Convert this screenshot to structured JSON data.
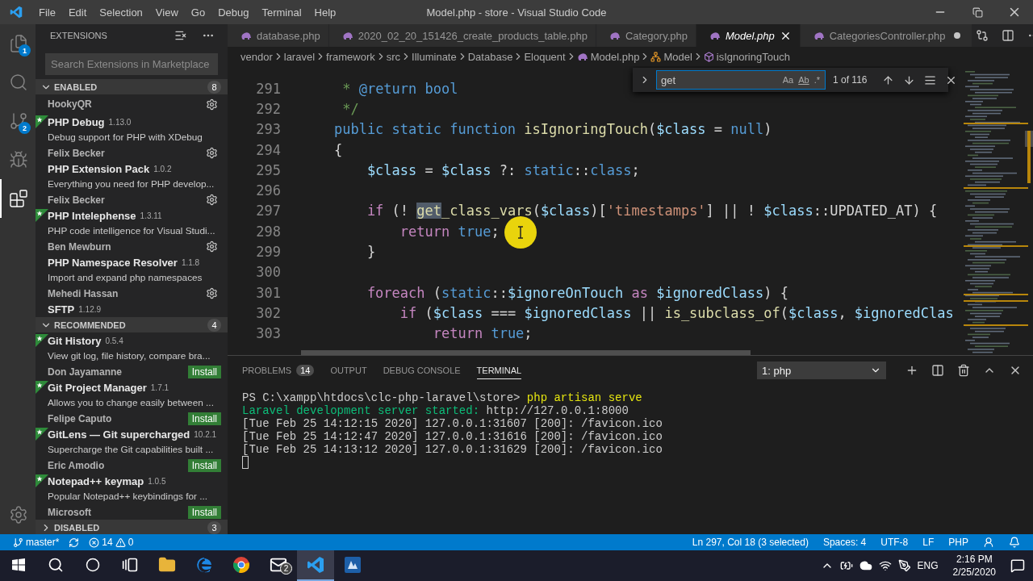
{
  "title_bar": {
    "menus": [
      "File",
      "Edit",
      "Selection",
      "View",
      "Go",
      "Debug",
      "Terminal",
      "Help"
    ],
    "title": "Model.php - store - Visual Studio Code"
  },
  "activity_bar": [
    {
      "kind": "explorer",
      "badge": "1",
      "selected": false
    },
    {
      "kind": "search",
      "selected": false
    },
    {
      "kind": "source-control",
      "badge": "2",
      "selected": false
    },
    {
      "kind": "debug",
      "selected": false
    },
    {
      "kind": "extensions",
      "selected": true
    }
  ],
  "sidebar": {
    "title": "EXTENSIONS",
    "search": {
      "placeholder": "Search Extensions in Marketplace"
    },
    "sections": [
      {
        "title": "ENABLED",
        "count": "8",
        "expanded": true,
        "items": [
          {
            "author": "HookyQR",
            "starred": false,
            "kind": "manage"
          },
          {
            "name": "PHP Debug",
            "version": "1.13.0",
            "description": "Debug support for PHP with XDebug",
            "author": "Felix Becker",
            "starred": true,
            "kind": "manage"
          },
          {
            "name": "PHP Extension Pack",
            "version": "1.0.2",
            "description": "Everything you need for PHP develop...",
            "author": "Felix Becker",
            "starred": false,
            "kind": "manage"
          },
          {
            "name": "PHP Intelephense",
            "version": "1.3.11",
            "description": "PHP code intelligence for Visual Studi...",
            "author": "Ben Mewburn",
            "starred": true,
            "kind": "manage"
          },
          {
            "name": "PHP Namespace Resolver",
            "version": "1.1.8",
            "description": "Import and expand php namespaces",
            "author": "Mehedi Hassan",
            "starred": false,
            "kind": "manage"
          },
          {
            "name": "SFTP",
            "version": "1.12.9",
            "starred": false
          }
        ]
      },
      {
        "title": "RECOMMENDED",
        "count": "4",
        "expanded": true,
        "items": [
          {
            "name": "Git History",
            "version": "0.5.4",
            "description": "View git log, file history, compare bra...",
            "author": "Don Jayamanne",
            "starred": true,
            "kind": "install",
            "action_label": "Install"
          },
          {
            "name": "Git Project Manager",
            "version": "1.7.1",
            "description": "Allows you to change easily between ...",
            "author": "Felipe Caputo",
            "starred": true,
            "kind": "install",
            "action_label": "Install"
          },
          {
            "name": "GitLens — Git supercharged",
            "version": "10.2.1",
            "description": "Supercharge the Git capabilities built ...",
            "author": "Eric Amodio",
            "starred": true,
            "kind": "install",
            "action_label": "Install"
          },
          {
            "name": "Notepad++ keymap",
            "version": "1.0.5",
            "description": "Popular Notepad++ keybindings for ...",
            "author": "Microsoft",
            "starred": true,
            "kind": "install",
            "action_label": "Install"
          }
        ]
      },
      {
        "title": "DISABLED",
        "count": "3",
        "expanded": false
      }
    ]
  },
  "tabs": [
    {
      "label": "database.php",
      "selected": false,
      "preview": false,
      "modified": false
    },
    {
      "label": "2020_02_20_151426_create_products_table.php",
      "selected": false,
      "preview": false,
      "modified": false
    },
    {
      "label": "Category.php",
      "selected": false,
      "preview": false,
      "modified": false
    },
    {
      "label": "Model.php",
      "selected": true,
      "preview": true,
      "modified": false
    },
    {
      "label": "CategoriesController.php",
      "selected": false,
      "preview": false,
      "modified": true
    }
  ],
  "breadcrumb": [
    {
      "kind": "folder",
      "label": "vendor"
    },
    {
      "kind": "folder",
      "label": "laravel"
    },
    {
      "kind": "folder",
      "label": "framework"
    },
    {
      "kind": "folder",
      "label": "src"
    },
    {
      "kind": "folder",
      "label": "Illuminate"
    },
    {
      "kind": "folder",
      "label": "Database"
    },
    {
      "kind": "folder",
      "label": "Eloquent"
    },
    {
      "kind": "file",
      "label": "Model.php"
    },
    {
      "kind": "class",
      "label": "Model"
    },
    {
      "kind": "method",
      "label": "isIgnoringTouch"
    }
  ],
  "find": {
    "value": "get",
    "toggles": [
      "Aa",
      "Ab",
      ".*"
    ],
    "result": "1 of 116"
  },
  "code": [
    {
      "number": "291",
      "tokens": [
        {
          "kind": "cm",
          "text": "     * "
        },
        {
          "kind": "kw",
          "text": "@return bool"
        }
      ]
    },
    {
      "number": "292",
      "tokens": [
        {
          "kind": "cm",
          "text": "     */"
        }
      ]
    },
    {
      "number": "293",
      "tokens": [
        {
          "kind": "kw",
          "text": "    public static function "
        },
        {
          "kind": "fn",
          "text": "isIgnoringTouch"
        },
        {
          "kind": "p",
          "text": "("
        },
        {
          "kind": "var",
          "text": "$class"
        },
        {
          "kind": "p",
          "text": " = "
        },
        {
          "kind": "kw",
          "text": "null"
        },
        {
          "kind": "p",
          "text": ")"
        }
      ]
    },
    {
      "number": "294",
      "tokens": [
        {
          "kind": "p",
          "text": "    {"
        }
      ]
    },
    {
      "number": "295",
      "tokens": [
        {
          "kind": "var",
          "text": "        $class"
        },
        {
          "kind": "p",
          "text": " = "
        },
        {
          "kind": "var",
          "text": "$class"
        },
        {
          "kind": "p",
          "text": " ?: "
        },
        {
          "kind": "kw",
          "text": "static"
        },
        {
          "kind": "p",
          "text": "::"
        },
        {
          "kind": "kw",
          "text": "class"
        },
        {
          "kind": "p",
          "text": ";"
        }
      ]
    },
    {
      "number": "296"
    },
    {
      "number": "297",
      "tokens": [
        {
          "kind": "ctl",
          "text": "        if"
        },
        {
          "kind": "p",
          "text": " (! "
        },
        {
          "kind": "match",
          "text": "get"
        },
        {
          "kind": "fn",
          "text": "_class_vars"
        },
        {
          "kind": "p",
          "text": "("
        },
        {
          "kind": "var",
          "text": "$class"
        },
        {
          "kind": "p",
          "text": ")["
        },
        {
          "kind": "str",
          "text": "'timestamps'"
        },
        {
          "kind": "p",
          "text": "] || ! "
        },
        {
          "kind": "var",
          "text": "$class"
        },
        {
          "kind": "p",
          "text": "::UPDATED_AT) {"
        }
      ]
    },
    {
      "number": "298",
      "tokens": [
        {
          "kind": "ctl",
          "text": "            return"
        },
        {
          "kind": "kw",
          "text": " true"
        },
        {
          "kind": "p",
          "text": ";"
        }
      ]
    },
    {
      "number": "299",
      "tokens": [
        {
          "kind": "p",
          "text": "        }"
        }
      ]
    },
    {
      "number": "300"
    },
    {
      "number": "301",
      "tokens": [
        {
          "kind": "ctl",
          "text": "        foreach"
        },
        {
          "kind": "p",
          "text": " ("
        },
        {
          "kind": "kw",
          "text": "static"
        },
        {
          "kind": "p",
          "text": "::"
        },
        {
          "kind": "var",
          "text": "$ignoreOnTouch"
        },
        {
          "kind": "ctl",
          "text": " as"
        },
        {
          "kind": "var",
          "text": " $ignoredClass"
        },
        {
          "kind": "p",
          "text": ") {"
        }
      ]
    },
    {
      "number": "302",
      "tokens": [
        {
          "kind": "ctl",
          "text": "            if"
        },
        {
          "kind": "p",
          "text": " ("
        },
        {
          "kind": "var",
          "text": "$class"
        },
        {
          "kind": "p",
          "text": " === "
        },
        {
          "kind": "var",
          "text": "$ignoredClass"
        },
        {
          "kind": "p",
          "text": " || "
        },
        {
          "kind": "fn",
          "text": "is_subclass_of"
        },
        {
          "kind": "p",
          "text": "("
        },
        {
          "kind": "var",
          "text": "$class"
        },
        {
          "kind": "p",
          "text": ", "
        },
        {
          "kind": "var",
          "text": "$ignoredClas"
        }
      ]
    },
    {
      "number": "303",
      "tokens": [
        {
          "kind": "ctl",
          "text": "                return"
        },
        {
          "kind": "kw",
          "text": " true"
        },
        {
          "kind": "p",
          "text": ";"
        }
      ]
    }
  ],
  "panel": {
    "tabs": [
      {
        "label": "PROBLEMS",
        "badge": "14",
        "selected": false
      },
      {
        "label": "OUTPUT",
        "selected": false
      },
      {
        "label": "DEBUG CONSOLE",
        "selected": false
      },
      {
        "label": "TERMINAL",
        "selected": true
      }
    ],
    "terminal_select": "1: php",
    "terminal": [
      [
        {
          "kind": "plain",
          "text": "PS C:\\xampp\\htdocs\\clc-php-laravel\\store> "
        },
        {
          "kind": "command",
          "text": "php artisan serve"
        }
      ],
      [
        {
          "kind": "success",
          "text": "Laravel development server started:"
        },
        {
          "kind": "plain",
          "text": " http://127.0.0.1:8000"
        }
      ],
      [
        {
          "kind": "plain",
          "text": "[Tue Feb 25 14:12:15 2020] 127.0.0.1:31607 [200]: /favicon.ico"
        }
      ],
      [
        {
          "kind": "plain",
          "text": "[Tue Feb 25 14:12:47 2020] 127.0.0.1:31616 [200]: /favicon.ico"
        }
      ],
      [
        {
          "kind": "plain",
          "text": "[Tue Feb 25 14:13:12 2020] 127.0.0.1:31629 [200]: /favicon.ico"
        }
      ]
    ]
  },
  "status_bar": {
    "branch": "master*",
    "errors": "14",
    "warnings": "0",
    "right": [
      "Ln 297, Col 18 (3 selected)",
      "Spaces: 4",
      "UTF-8",
      "LF",
      "PHP"
    ]
  },
  "taskbar": {
    "apps": [
      {
        "kind": "search",
        "active": false
      },
      {
        "kind": "cortana",
        "active": false
      },
      {
        "kind": "task-view",
        "active": false
      },
      {
        "kind": "folder",
        "active": false
      },
      {
        "kind": "edge",
        "active": false
      },
      {
        "kind": "chrome",
        "active": false
      },
      {
        "kind": "mail",
        "badge": "2",
        "active": false
      },
      {
        "kind": "vscode",
        "active": true
      },
      {
        "kind": "app",
        "active": false
      }
    ],
    "language": "ENG",
    "time": "2:16 PM",
    "date": "2/25/2020"
  }
}
